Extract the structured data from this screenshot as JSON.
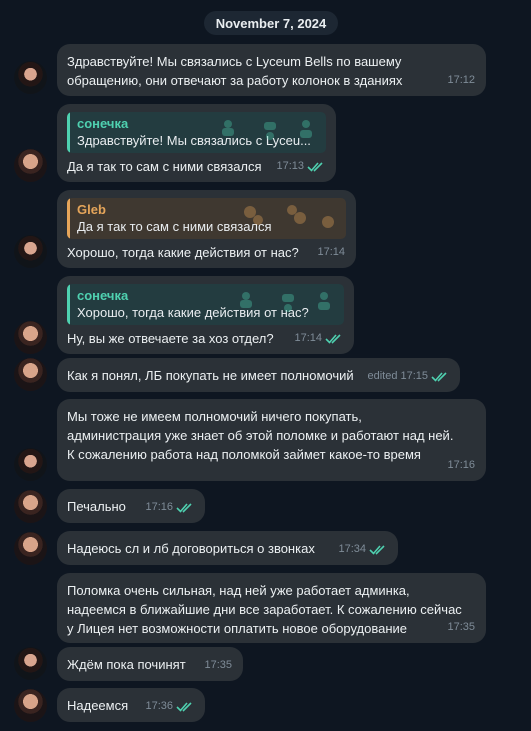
{
  "date_separator": "November 7, 2024",
  "colors": {
    "background": "#0e1621",
    "bubble": "#2b3137",
    "accent_teal": "#4fd1b0",
    "accent_orange": "#e5a55a",
    "read_check": "#4fd1b0"
  },
  "messages": [
    {
      "text": "Здравствуйте! Мы связались с Lyceum Bells по вашему\nобращению, они отвечают за работу колонок в зданиях",
      "time": "17:12"
    },
    {
      "reply": {
        "author": "сонечка",
        "text": "Здравствуйте! Мы связались с Lyceu..."
      },
      "text": "Да я так то сам с ними связался",
      "time": "17:13",
      "icon": "double-check-icon"
    },
    {
      "reply": {
        "author": "Gleb",
        "text": "Да я так то сам с ними связался"
      },
      "text": "Хорошо, тогда какие действия от нас?",
      "time": "17:14"
    },
    {
      "reply": {
        "author": "сонечка",
        "text": "Хорошо, тогда какие действия от нас?"
      },
      "text": "Ну, вы же отвечаете за хоз отдел?",
      "time": "17:14",
      "icon": "double-check-icon"
    },
    {
      "text": "Как я понял, ЛБ покупать не имеет полномочий",
      "edited": "edited",
      "time": "17:15",
      "icon": "double-check-icon"
    },
    {
      "text": "Мы тоже не имеем полномочий ничего покупать,\nадминистрация уже знает об этой поломке и работают над ней.\nК сожалению работа над поломкой займет какое-то время",
      "time": "17:16"
    },
    {
      "text": "Печально",
      "time": "17:16",
      "icon": "double-check-icon"
    },
    {
      "text": "Надеюсь сл и лб договориться о звонках",
      "time": "17:34",
      "icon": "double-check-icon"
    },
    {
      "text": "Поломка очень сильная, над ней уже работает админка,\nнадеемся в ближайшие дни все заработает. К сожалению сейчас\nу Лицея нет возможности оплатить новое оборудование",
      "time": "17:35"
    },
    {
      "text": "Ждём пока починят",
      "time": "17:35"
    },
    {
      "text": "Надеемся",
      "time": "17:36",
      "icon": "double-check-icon"
    }
  ]
}
